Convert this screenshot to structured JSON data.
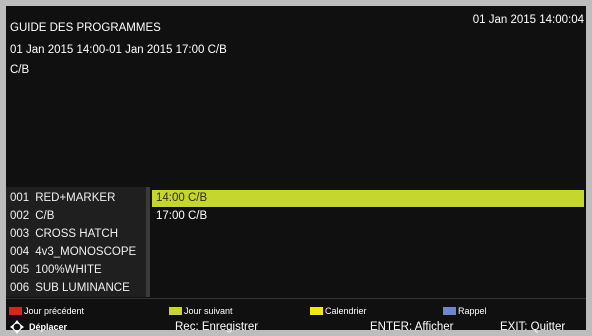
{
  "header": {
    "title": "GUIDE DES PROGRAMMES",
    "clock": "01 Jan 2015 14:00:04",
    "time_range": "01 Jan 2015 14:00-01 Jan 2015 17:00 C/B",
    "program_name": "C/B"
  },
  "channels": [
    {
      "num": "001",
      "name": "RED+MARKER"
    },
    {
      "num": "002",
      "name": "C/B"
    },
    {
      "num": "003",
      "name": "CROSS HATCH"
    },
    {
      "num": "004",
      "name": "4v3_MONOSCOPE"
    },
    {
      "num": "005",
      "name": "100%WHITE"
    },
    {
      "num": "006",
      "name": "SUB LUMINANCE"
    }
  ],
  "events": [
    {
      "label": "14:00 C/B",
      "selected": true
    },
    {
      "label": "17:00 C/B",
      "selected": false
    }
  ],
  "legend": [
    {
      "label": "Jour précédent",
      "color": "#e0201c"
    },
    {
      "label": "Jour suivant",
      "color": "#c5d62c"
    },
    {
      "label": "Calendrier",
      "color": "#f2e51a"
    },
    {
      "label": "Rappel",
      "color": "#6f86cf"
    }
  ],
  "hints": {
    "move": "Déplacer",
    "rec": "Rec: Enregistrer",
    "enter": "ENTER: Afficher",
    "exit": "EXIT: Quitter"
  },
  "colors": {
    "selection": "#c5d62c",
    "background": "#101010",
    "frame": "#bdbdbd"
  }
}
